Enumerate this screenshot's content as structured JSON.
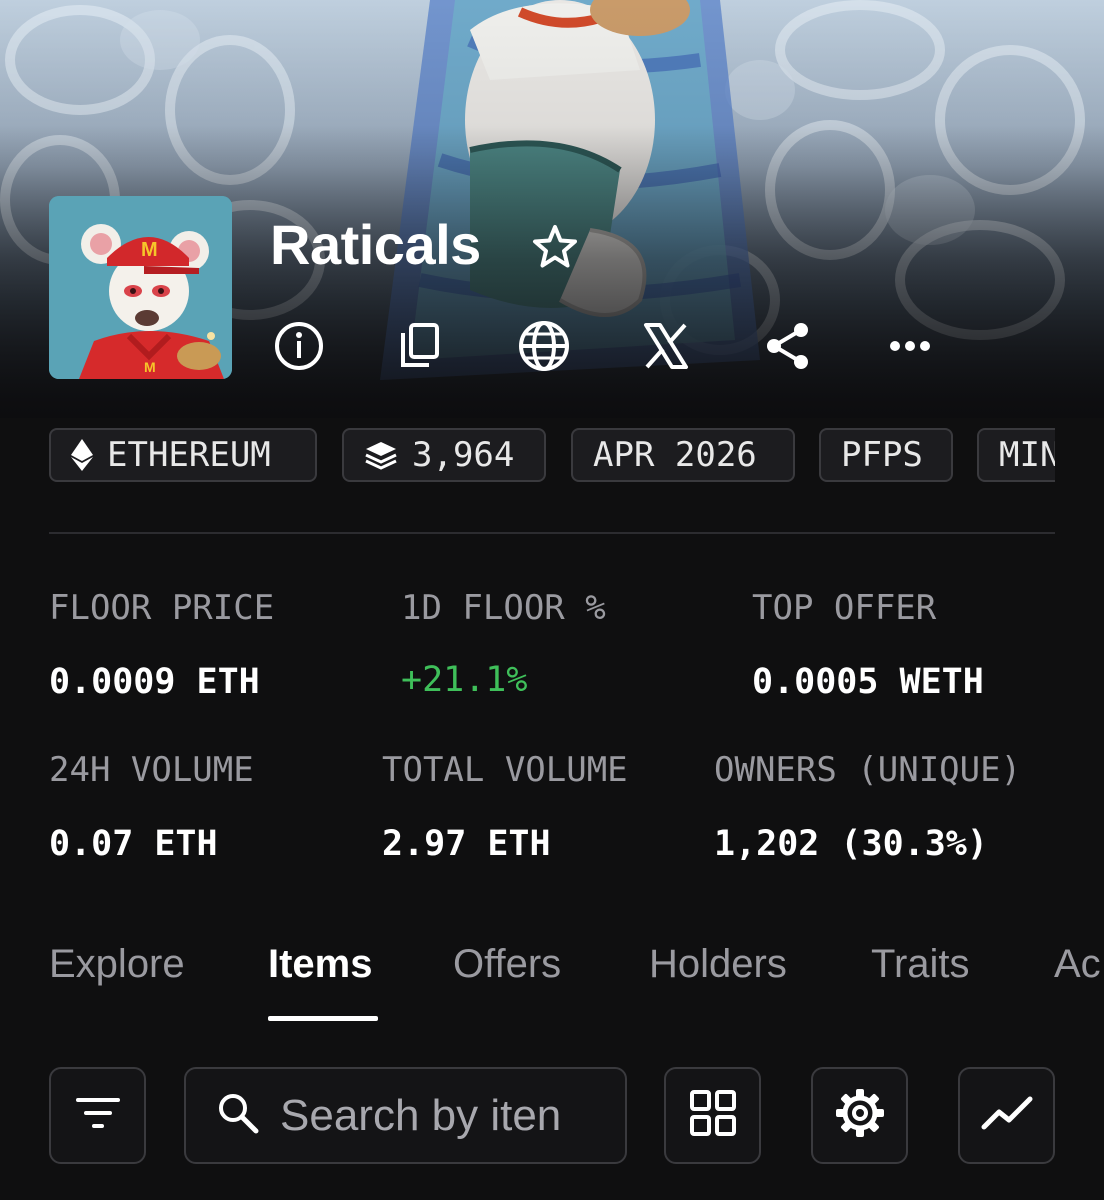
{
  "collection": {
    "name": "Raticals",
    "chips": [
      {
        "label": "ETHEREUM",
        "icon": "ethereum-icon"
      },
      {
        "label": "3,964",
        "icon": "layers-icon"
      },
      {
        "label": "APR 2026"
      },
      {
        "label": "PFPS"
      },
      {
        "label": "MIN"
      }
    ]
  },
  "stats": {
    "floor_price": {
      "label": "FLOOR PRICE",
      "value": "0.0009 ETH"
    },
    "floor_change": {
      "label": "1D FLOOR %",
      "value": "+21.1%"
    },
    "top_offer": {
      "label": "TOP OFFER",
      "value": "0.0005 WETH"
    },
    "volume_24h": {
      "label": "24H VOLUME",
      "value": "0.07 ETH"
    },
    "total_volume": {
      "label": "TOTAL VOLUME",
      "value": "2.97 ETH"
    },
    "owners": {
      "label": "OWNERS (UNIQUE)",
      "value": "1,202 (30.3%)"
    }
  },
  "tabs": [
    "Explore",
    "Items",
    "Offers",
    "Holders",
    "Traits",
    "Ac"
  ],
  "active_tab": "Items",
  "search": {
    "placeholder": "Search by iten"
  },
  "colors": {
    "background": "#0f0f10",
    "positive": "#3fbf5a",
    "muted_text": "#9a9aa0",
    "border": "#3a3a3e"
  },
  "icons": {
    "favorite": "star-icon",
    "actions": [
      "info-icon",
      "copy-icon",
      "globe-icon",
      "x-logo-icon",
      "share-icon",
      "more-icon"
    ],
    "toolbar": [
      "filter-icon",
      "search-icon",
      "grid-view-icon",
      "settings-icon",
      "chart-icon"
    ]
  }
}
